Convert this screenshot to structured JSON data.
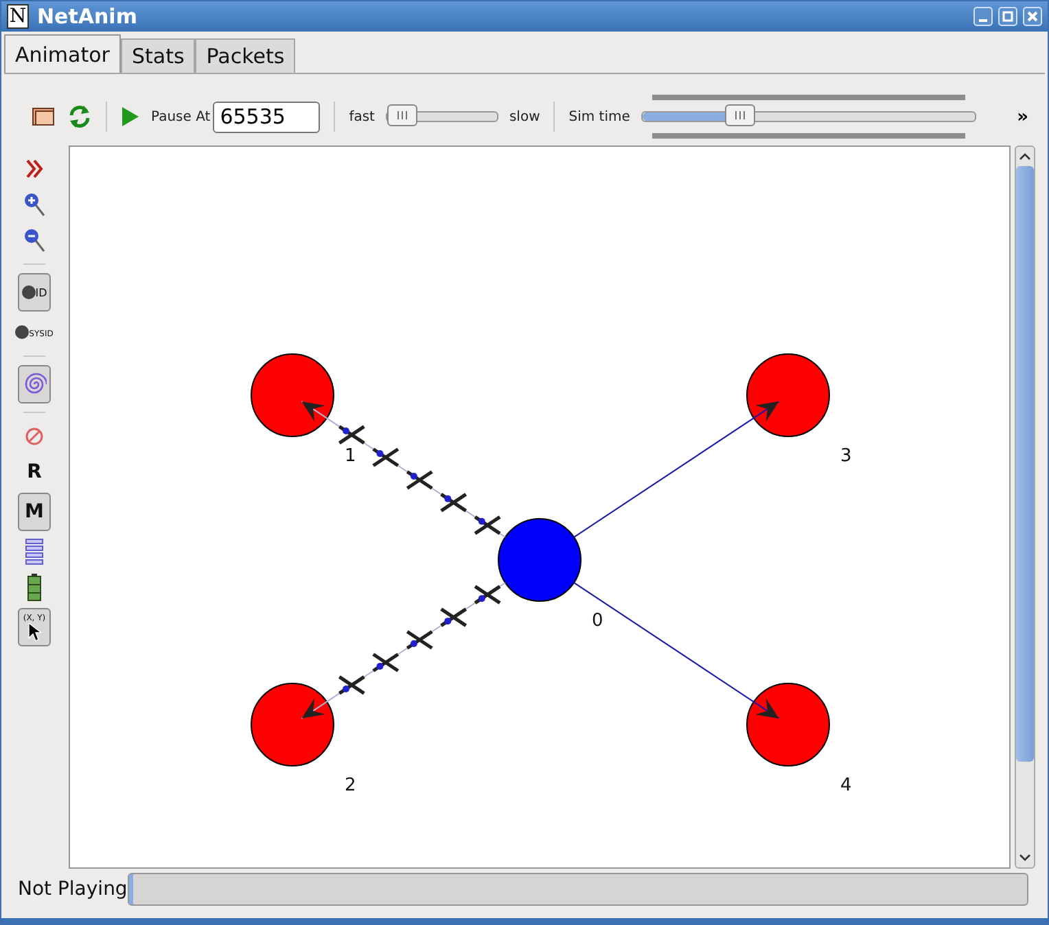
{
  "window": {
    "title": "NetAnim",
    "icon": "N"
  },
  "tabs": [
    {
      "label": "Animator",
      "selected": true
    },
    {
      "label": "Stats",
      "selected": false
    },
    {
      "label": "Packets",
      "selected": false
    }
  ],
  "toolbar": {
    "pause_label": "Pause At",
    "pause_value": "65535",
    "fast_label": "fast",
    "slow_label": "slow",
    "speed": {
      "level": 0.0
    },
    "sim_time_label": "Sim time",
    "sim_time": {
      "level": 0.29
    },
    "more": "»"
  },
  "side_tools": [
    {
      "kind": "chevrons",
      "on": false
    },
    {
      "kind": "zoom-in",
      "on": false
    },
    {
      "kind": "zoom-out",
      "on": false
    },
    {
      "kind": "node-id",
      "label": "ID",
      "on": true
    },
    {
      "kind": "system-id",
      "label": "SYSID",
      "on": false
    },
    {
      "kind": "spiral",
      "on": true
    },
    {
      "kind": "no-sign",
      "on": false
    },
    {
      "kind": "letter",
      "label": "R",
      "on": false
    },
    {
      "kind": "letter",
      "label": "M",
      "on": true
    },
    {
      "kind": "lines",
      "on": false
    },
    {
      "kind": "battery",
      "on": false
    },
    {
      "kind": "position",
      "label": "(X, Y)",
      "on": true
    }
  ],
  "nodes": [
    {
      "label": "0",
      "color": "#0000ff"
    },
    {
      "label": "1",
      "color": "#ff0000"
    },
    {
      "label": "2",
      "color": "#ff0000"
    },
    {
      "label": "3",
      "color": "#ff0000"
    },
    {
      "label": "4",
      "color": "#ff0000"
    }
  ],
  "links": [
    {
      "kind": "packets"
    },
    {
      "kind": "packets"
    },
    {
      "kind": "plain"
    },
    {
      "kind": "plain"
    }
  ],
  "status": {
    "text": "Not Playing",
    "progress": {
      "level": 0.0
    }
  }
}
